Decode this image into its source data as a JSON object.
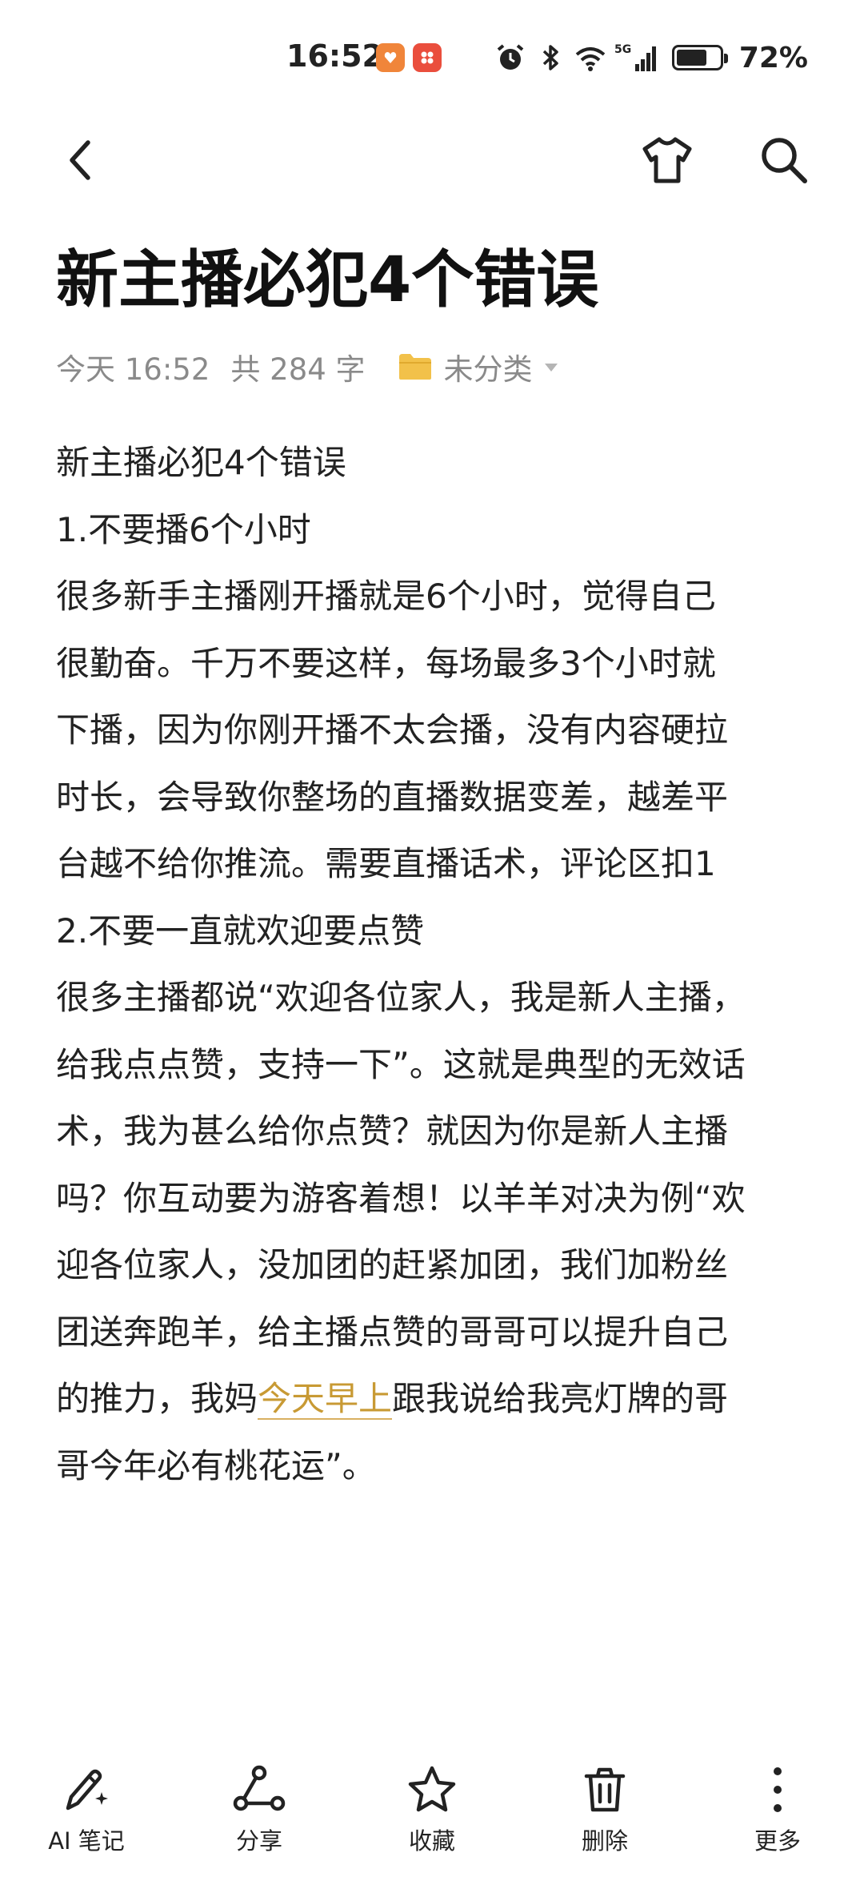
{
  "status_bar": {
    "time": "16:52",
    "network": "5G",
    "battery_percent": "72%",
    "battery_level": 0.72,
    "icons": [
      "alarm-icon",
      "bluetooth-icon",
      "wifi-icon",
      "signal-icon",
      "battery-icon"
    ]
  },
  "toolbar": {
    "back_icon": "chevron-left-icon",
    "theme_icon": "tshirt-icon",
    "search_icon": "search-icon"
  },
  "note": {
    "title": "新主播必犯4个错误",
    "meta": {
      "date": "今天 16:52",
      "count": "共 284 字",
      "folder": "未分类"
    },
    "lines": [
      "新主播必犯4个错误",
      "1.不要播6个小时",
      "很多新手主播刚开播就是6个小时，觉得自己",
      "很勤奋。千万不要这样，每场最多3个小时就",
      "下播，因为你刚开播不太会播，没有内容硬拉",
      "时长，会导致你整场的直播数据变差，越差平",
      "台越不给你推流。需要直播话术，评论区扣1",
      "2.不要一直就欢迎要点赞",
      "很多主播都说“欢迎各位家人，我是新人主播，",
      "给我点点赞，支持一下”。这就是典型的无效话",
      "术，我为甚么给你点赞？就因为你是新人主播",
      "吗？你互动要为游客着想！以羊羊对决为例“欢",
      "迎各位家人，没加团的赶紧加团，我们加粉丝",
      "团送奔跑羊，给主播点赞的哥哥可以提升自己"
    ],
    "link_line": {
      "before": "的推力，我妈",
      "link": "今天早上",
      "after": "跟我说给我亮灯牌的哥"
    },
    "last_line": "哥今年必有桃花运”。"
  },
  "bottom_bar": {
    "ai_label": "AI 笔记",
    "share_label": "分享",
    "favorite_label": "收藏",
    "delete_label": "删除",
    "more_label": "更多"
  },
  "colors": {
    "link": "#c89a34",
    "folder": "#f2c14a",
    "meta_text": "#8a8a8a"
  }
}
